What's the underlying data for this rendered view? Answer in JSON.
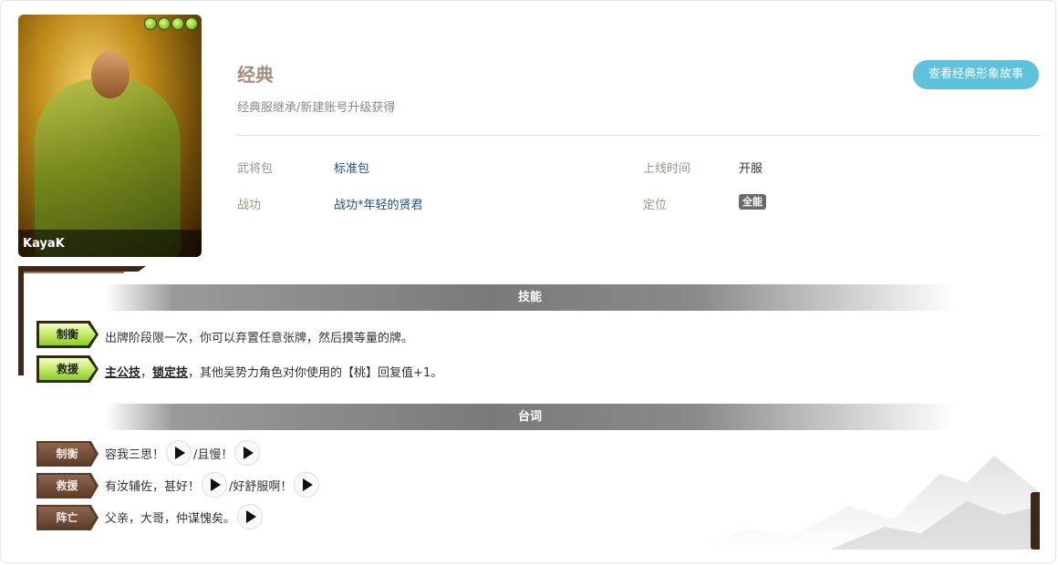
{
  "skin": {
    "artist": "KayaK",
    "magatama_count": 4,
    "name": "经典",
    "obtain": "经典服继承/新建账号升级获得",
    "story_button": "查看经典形象故事"
  },
  "info": {
    "package_label": "武将包",
    "package_value": "标准包",
    "release_label": "上线时间",
    "release_value": "开服",
    "merit_label": "战功",
    "merit_value": "战功*年轻的贤君",
    "role_label": "定位",
    "role_value": "全能"
  },
  "skills": {
    "header": "技能",
    "items": [
      {
        "name": "制衡",
        "desc": "出牌阶段限一次，你可以弃置任意张牌，然后摸等量的牌。"
      },
      {
        "name": "救援",
        "kw1": "主公技",
        "sep": "，",
        "kw2": "锁定技",
        "desc": "，其他吴势力角色对你使用的【桃】回复值+1。"
      }
    ]
  },
  "lines": {
    "header": "台词",
    "items": [
      {
        "tag": "制衡",
        "text1": "容我三思！",
        "text2": "/且慢！"
      },
      {
        "tag": "救援",
        "text1": "有汝辅佐，甚好！",
        "text2": "/好舒服啊！"
      },
      {
        "tag": "阵亡",
        "text1": "父亲，大哥，仲谋愧矣。"
      }
    ]
  }
}
